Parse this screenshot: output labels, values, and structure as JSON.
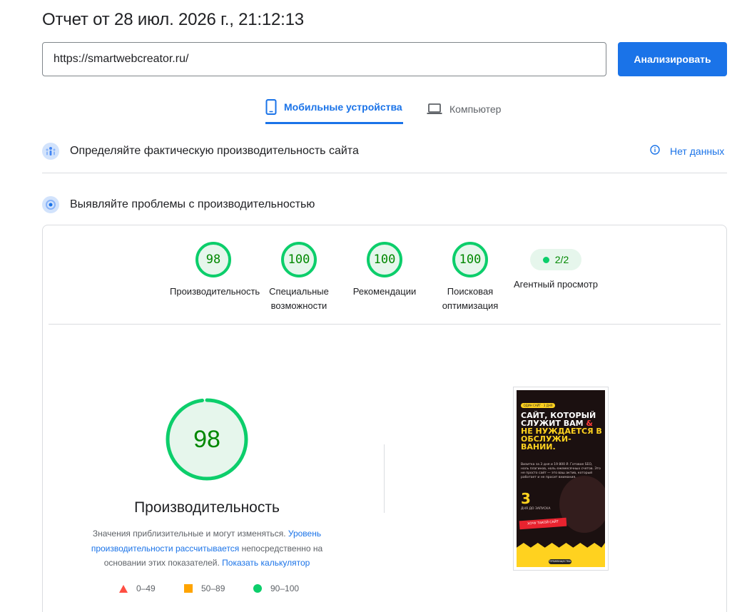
{
  "report": {
    "title": "Отчет от 28 июл. 2026 г., 21:12:13"
  },
  "search": {
    "url": "https://smartwebcreator.ru/",
    "analyze_label": "Анализировать"
  },
  "tabs": {
    "mobile": "Мобильные устройства",
    "desktop": "Компьютер"
  },
  "field_section": {
    "label": "Определяйте фактическую производительность сайта",
    "no_data": "Нет данных"
  },
  "lab_section": {
    "label": "Выявляйте проблемы с производительностью"
  },
  "categories": [
    {
      "score": "98",
      "label": "Производительность"
    },
    {
      "score": "100",
      "label": "Специальные возможности"
    },
    {
      "score": "100",
      "label": "Рекомендации"
    },
    {
      "score": "100",
      "label": "Поисковая оптимизация"
    }
  ],
  "agent": {
    "value": "2/2",
    "label": "Агентный просмотр"
  },
  "performance": {
    "score": "98",
    "score_fraction": 0.98,
    "title": "Производительность",
    "desc_start": "Значения приблизительные и могут изменяться. ",
    "desc_link1": "Уровень производительности рассчитывается",
    "desc_mid": " непосредственно на основании этих показателей. ",
    "desc_link2": "Показать калькулятор"
  },
  "legend": {
    "fail": "0–49",
    "average": "50–89",
    "pass": "90–100"
  },
  "colors": {
    "accent": "#1a73e8",
    "pass": "#0cce6b",
    "average": "#ffa400",
    "fail": "#ff4e42"
  },
  "screenshot": {
    "chip": "ОДИН САЙТ · 3 ДНЯ",
    "headline_1": "САЙТ, КОТОРЫЙ СЛУЖИТ ВАМ",
    "headline_amp": "&",
    "headline_2": "НЕ НУЖДАЕТСЯ В ОБСЛУЖИ-ВАНИИ.",
    "body": "Визитка за 3 дня и 19 800 ₽. Готовое SEO, ноль плагинов, ноль ежемесячных счетов. Это не просто сайт — это ваш актив, который работает и не просит внимания.",
    "number": "3",
    "number_caption": "ДНЯ ДО ЗАПУСКА",
    "cta": "ХОЧУ ТАКОЙ САЙТ",
    "badge": "ПРЕИМУЩЕСТВА"
  }
}
